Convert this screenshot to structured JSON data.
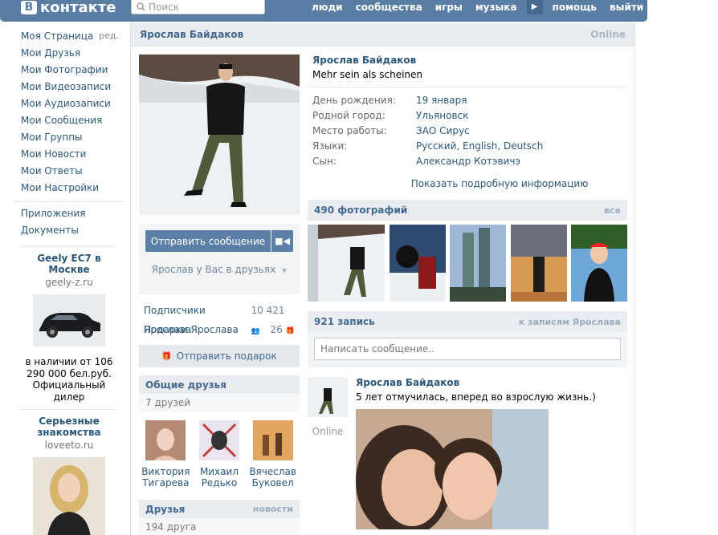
{
  "header": {
    "logo_icon": "В",
    "logo_text": "контакте",
    "search_placeholder": "Поиск",
    "nav": [
      "люди",
      "сообщества",
      "игры",
      "музыка",
      "помощь",
      "выйти"
    ],
    "more_icon": "▶"
  },
  "leftmenu": {
    "items": [
      "Моя Страница",
      "Мои Друзья",
      "Мои Фотографии",
      "Мои Видеозаписи",
      "Мои Аудиозаписи",
      "Мои Сообщения",
      "Мои Группы",
      "Мои Новости",
      "Мои Ответы",
      "Мои Настройки"
    ],
    "edit": "ред.",
    "extra": [
      "Приложения",
      "Документы"
    ]
  },
  "ads": [
    {
      "title": "Geely EC7 в Москве",
      "domain": "geely-z.ru",
      "text": "в наличии от 106 290 000 бел.руб. Официальный дилер"
    },
    {
      "title": "Серьезные знакомства",
      "domain": "loveeto.ru"
    }
  ],
  "page": {
    "name": "Ярослав Байдаков",
    "online": "Online"
  },
  "actions": {
    "send_message": "Отправить сообщение",
    "video_icon": "■◀",
    "friend_status": "Ярослав у Вас в друзьях",
    "dropdown_icon": "▼"
  },
  "counts": [
    {
      "label": "Подписчики Ярослава",
      "value": "10 421"
    },
    {
      "label": "Подарки Ярослава",
      "value": "26"
    }
  ],
  "gift": {
    "label": "Отправить подарок",
    "icon": "🎁"
  },
  "mutual": {
    "title": "Общие друзья",
    "subtitle": "7 друзей",
    "friends": [
      {
        "first": "Виктория",
        "last": "Тигарева"
      },
      {
        "first": "Михаил",
        "last": "Редько"
      },
      {
        "first": "Вячеслав",
        "last": "Буковел"
      }
    ]
  },
  "friends": {
    "title": "Друзья",
    "link": "новости",
    "count": "194 друга"
  },
  "profile": {
    "name": "Ярослав Байдаков",
    "status": "Mehr sein als scheinen",
    "info": [
      {
        "k": "День рождения:",
        "v": "19 января"
      },
      {
        "k": "Родной город:",
        "v": "Ульяновск"
      },
      {
        "k": "Место работы:",
        "v": "ЗАО Сирус"
      },
      {
        "k": "Языки:",
        "v": "Русский, English, Deutsch"
      },
      {
        "k": "Сын:",
        "v": "Александр Котэвичэ"
      }
    ],
    "more": "Показать подробную информацию"
  },
  "photos": {
    "title": "490 фотографий",
    "link": "все"
  },
  "wall": {
    "title": "921 запись",
    "link": "к записям Ярослава",
    "placeholder": "Написать сообщение..",
    "post": {
      "author": "Ярослав Байдаков",
      "text": "5 лет отмучилась, вперед во взрослую жизнь.)",
      "status": "Online"
    }
  }
}
